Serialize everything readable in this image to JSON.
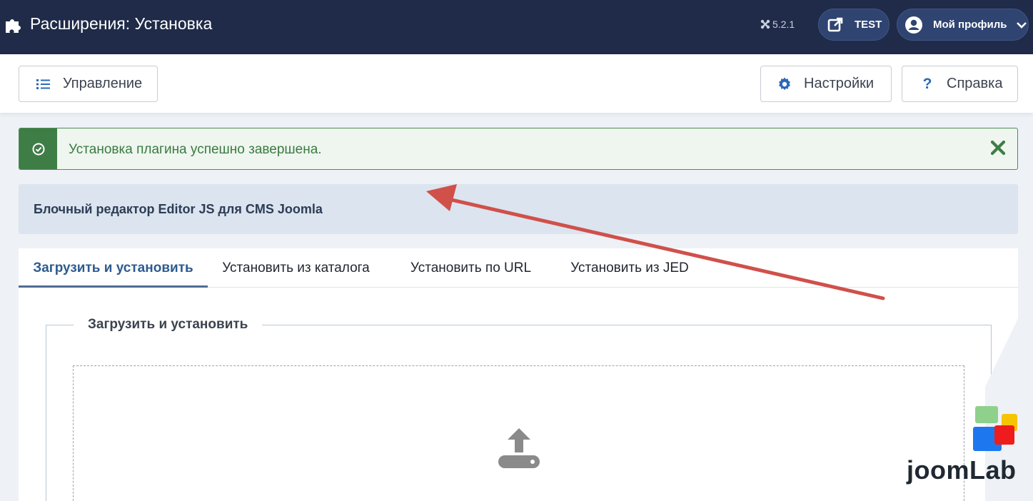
{
  "header": {
    "title": "Расширения: Установка",
    "version": "5.2.1",
    "site_button_label": "TEST",
    "profile_button_label": "Мой профиль"
  },
  "toolbar": {
    "manage_label": "Управление",
    "settings_label": "Настройки",
    "help_label": "Справка"
  },
  "alert": {
    "message": "Установка плагина успешно завершена.",
    "status": "success"
  },
  "info": {
    "text": "Блочный редактор Editor JS для CMS Joomla"
  },
  "tabs": [
    {
      "label": "Загрузить и установить",
      "active": true
    },
    {
      "label": "Установить из каталога",
      "active": false
    },
    {
      "label": "Установить по URL",
      "active": false
    },
    {
      "label": "Установить из JED",
      "active": false
    }
  ],
  "upload": {
    "legend": "Загрузить и установить"
  },
  "watermark": {
    "text": "joomLab"
  },
  "colors": {
    "header_bg": "#1f2b48",
    "success": "#3f7d46",
    "annotation_arrow": "#d0504a",
    "logo_green": "#8fd08d",
    "logo_yellow": "#f6c400",
    "logo_blue": "#1d78f0",
    "logo_red": "#ee1c1c"
  },
  "icons": {
    "header": "puzzle-icon",
    "site": "external-link-icon",
    "profile": "user-circle-icon",
    "manage": "list-icon",
    "settings": "gear-icon",
    "help": "question-icon",
    "alert": "check-circle-icon",
    "close": "close-icon",
    "upload": "upload-icon"
  }
}
